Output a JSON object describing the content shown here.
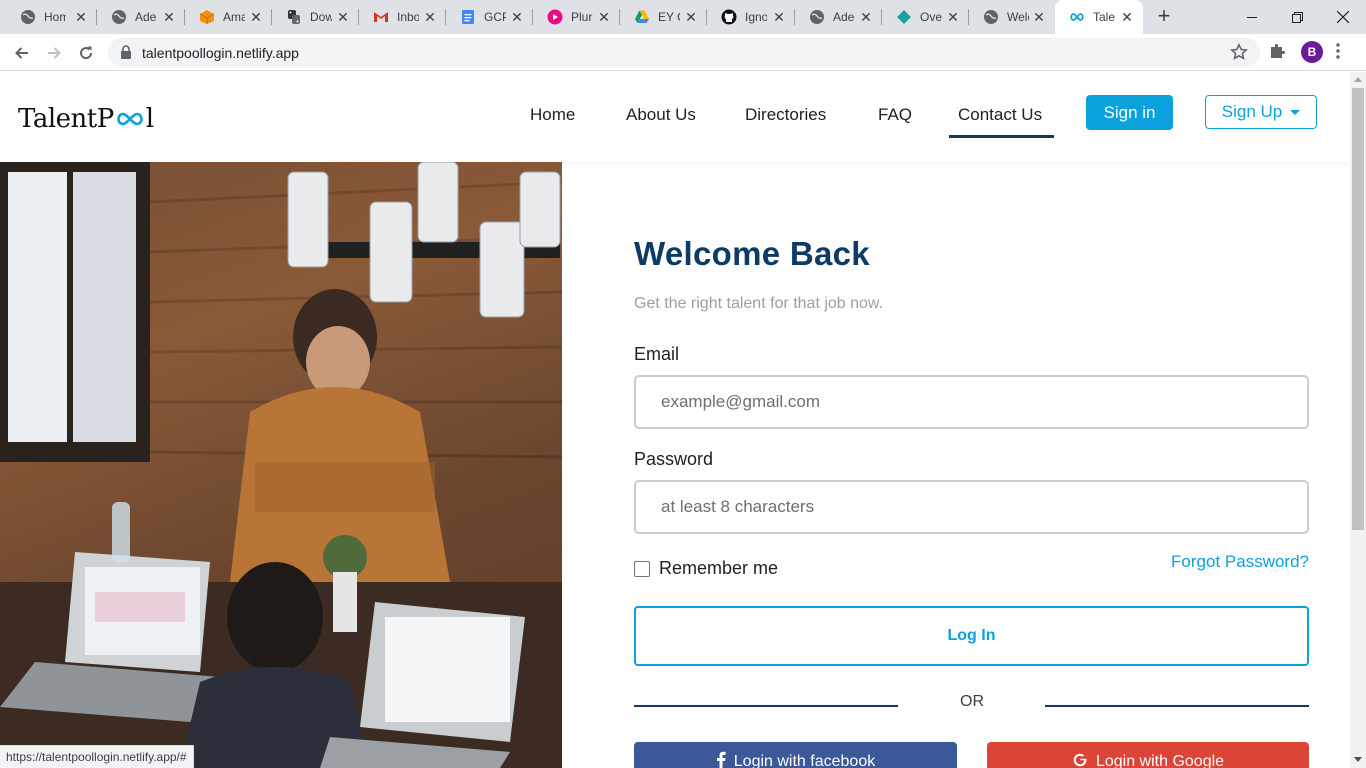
{
  "browser": {
    "tabs": [
      {
        "title": "Home",
        "icon": "globe-icon",
        "active": false
      },
      {
        "title": "Adedayo",
        "icon": "globe-icon",
        "active": false
      },
      {
        "title": "Amazon",
        "icon": "aws-box-icon",
        "active": false
      },
      {
        "title": "Download",
        "icon": "python-icon",
        "active": false
      },
      {
        "title": "Inbox",
        "icon": "gmail-icon",
        "active": false
      },
      {
        "title": "GCP",
        "icon": "docs-icon",
        "active": false
      },
      {
        "title": "Pluralsight",
        "icon": "pluralsight-icon",
        "active": false
      },
      {
        "title": "EY C",
        "icon": "drive-icon",
        "active": false
      },
      {
        "title": "Ignore",
        "icon": "github-icon",
        "active": false
      },
      {
        "title": "Adedayo",
        "icon": "globe-icon",
        "active": false
      },
      {
        "title": "Overview",
        "icon": "diamond-icon",
        "active": false
      },
      {
        "title": "Welcome",
        "icon": "globe-icon",
        "active": false
      },
      {
        "title": "TalentPool",
        "icon": "infinity-icon",
        "active": true
      }
    ],
    "new_tab": "+",
    "url": "talentpoollogin.netlify.app",
    "profile_initial": "B",
    "status_url": "https://talentpoollogin.netlify.app/#"
  },
  "header": {
    "logo_text_pre": "TalentP",
    "logo_text_post": "l",
    "nav": [
      "Home",
      "About Us",
      "Directories",
      "FAQ",
      "Contact Us"
    ],
    "active_nav": "Contact Us",
    "signin_label": "Sign in",
    "signup_label": "Sign Up"
  },
  "login": {
    "title": "Welcome Back",
    "subtitle": "Get the right talent for that job now.",
    "email_label": "Email",
    "email_placeholder": "example@gmail.com",
    "password_label": "Password",
    "password_placeholder": "at least 8 characters",
    "remember_label": "Remember me",
    "forgot_label": "Forgot Password?",
    "login_button": "Log In",
    "or_text": "OR",
    "facebook_label": "Login with facebook",
    "google_label": "Login with Google"
  },
  "colors": {
    "brand_blue": "#0aa1dd",
    "navy": "#0d3b66",
    "facebook": "#3b5998",
    "google": "#db4437"
  }
}
